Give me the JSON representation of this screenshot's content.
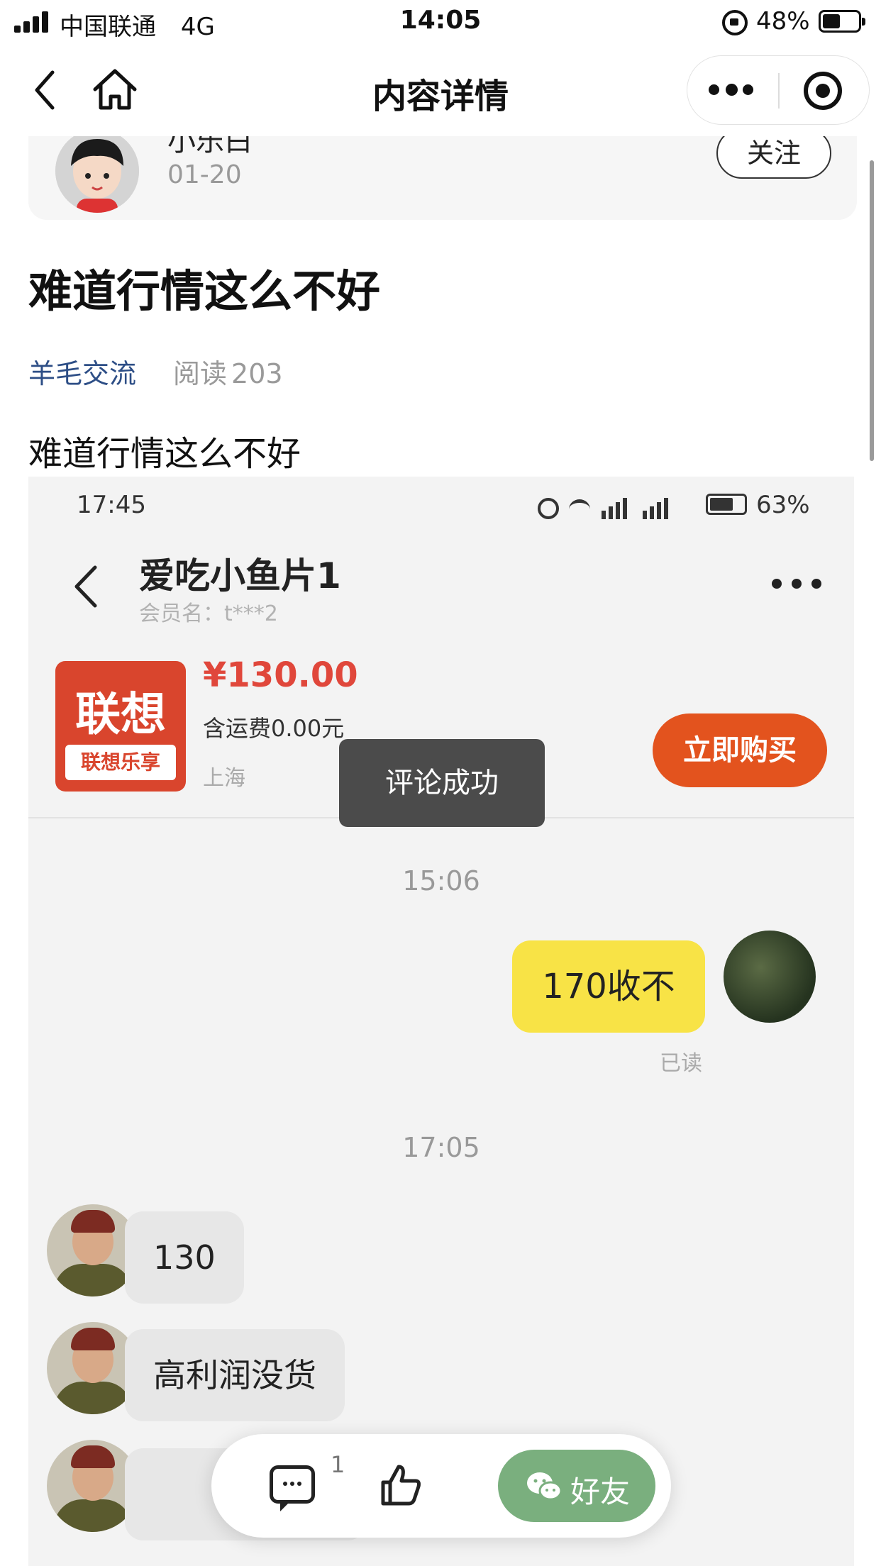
{
  "status_bar": {
    "carrier": "中国联通",
    "network": "4G",
    "time": "14:05",
    "battery_percent": "48%"
  },
  "nav": {
    "title": "内容详情",
    "icons": [
      "back-icon",
      "home-icon",
      "more-icon",
      "target-icon"
    ]
  },
  "author": {
    "name": "小乐白",
    "date": "01-20",
    "follow_label": "关注"
  },
  "post": {
    "title": "难道行情这么不好",
    "tag": "羊毛交流",
    "reads_label": "阅读",
    "reads_count": "203",
    "body": "难道行情这么不好"
  },
  "embedded": {
    "time": "17:45",
    "battery": "63%",
    "chat_name": "爱吃小鱼片1",
    "member": "会员名：t***2",
    "product_logo_big": "联想",
    "product_logo_small": "联想乐享",
    "price": "¥130.00",
    "shipping": "含运费0.00元",
    "location": "上海",
    "buy_label": "立即购买",
    "messages": [
      {
        "time": "15:06"
      },
      {
        "from": "me",
        "text": "170收不",
        "status": "已读"
      },
      {
        "time": "17:05"
      },
      {
        "from": "other",
        "text": "130"
      },
      {
        "from": "other",
        "text": "高利润没货"
      }
    ]
  },
  "toast": "评论成功",
  "actions": {
    "comment_count": "1",
    "share_label": "好友"
  },
  "colors": {
    "link": "#2d4e86",
    "price": "#e0473b",
    "buy_button": "#e3531e",
    "my_bubble": "#f8e346",
    "share_button": "#7aaf7e"
  }
}
